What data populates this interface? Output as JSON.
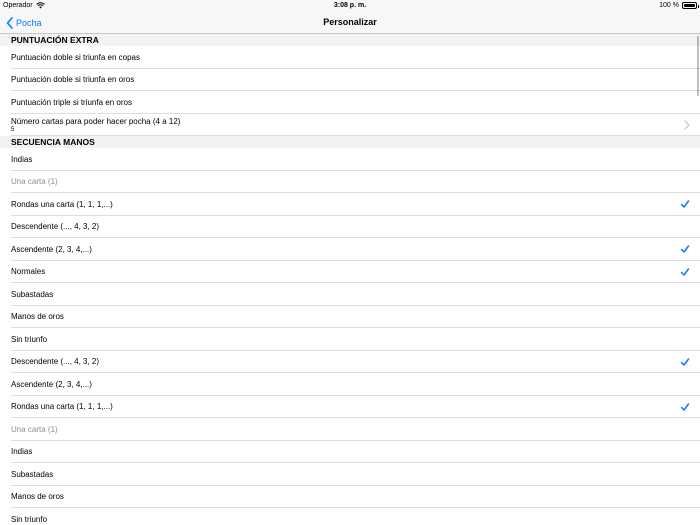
{
  "status": {
    "carrier": "Operador",
    "time": "3:08 p. m.",
    "battery_text": "100 %",
    "battery_level": 1.0
  },
  "nav": {
    "back_label": "Pocha",
    "title": "Personalizar"
  },
  "colors": {
    "accent": "#0a7aff",
    "disabled_text": "#8e8e93"
  },
  "sections": [
    {
      "header": "PUNTUACIÓN EXTRA",
      "rows": [
        {
          "label": "Puntuación doble si triunfa en copas"
        },
        {
          "label": "Puntuación doble si triunfa en oros"
        },
        {
          "label": "Puntuación triple si triunfa en oros"
        },
        {
          "label": "Número cartas para poder hacer pocha (4 a 12)",
          "value": "5",
          "disclosure": true
        }
      ]
    },
    {
      "header": "SECUENCIA MANOS",
      "rows": [
        {
          "label": "Indias"
        },
        {
          "label": "Una carta (1)",
          "disabled": true
        },
        {
          "label": "Rondas una carta (1, 1, 1,...)",
          "checked": true
        },
        {
          "label": "Descendente (..., 4, 3, 2)"
        },
        {
          "label": "Ascendente (2, 3, 4,...)",
          "checked": true
        },
        {
          "label": "Normales",
          "checked": true
        },
        {
          "label": "Subastadas"
        },
        {
          "label": "Manos de oros"
        },
        {
          "label": "Sin triunfo"
        },
        {
          "label": "Descendente (..., 4, 3, 2)",
          "checked": true
        },
        {
          "label": "Ascendente (2, 3, 4,...)"
        },
        {
          "label": "Rondas una carta (1, 1, 1,...)",
          "checked": true
        },
        {
          "label": "Una carta (1)",
          "disabled": true
        },
        {
          "label": "Indias"
        },
        {
          "label": "Subastadas"
        },
        {
          "label": "Manos de oros"
        },
        {
          "label": "Sin triunfo"
        }
      ]
    }
  ]
}
